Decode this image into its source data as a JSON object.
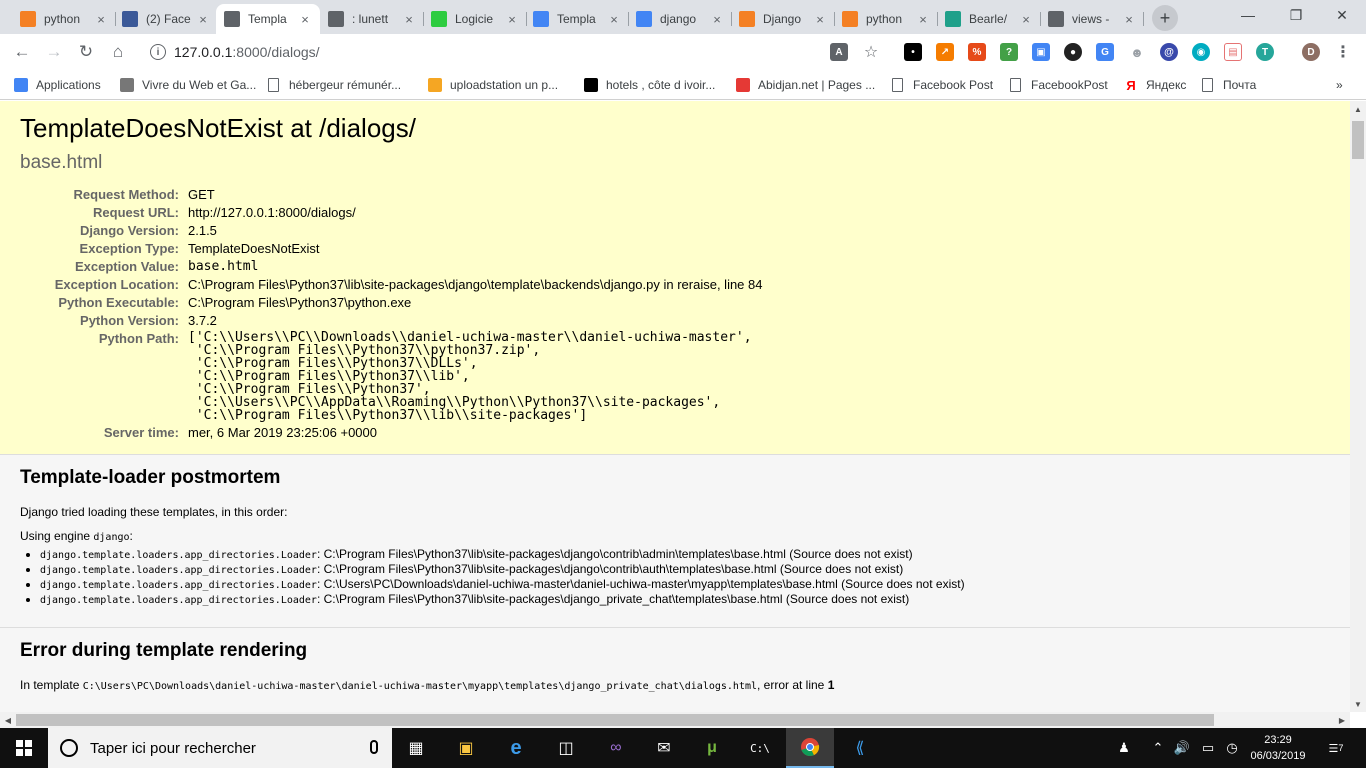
{
  "browser": {
    "tabs": [
      {
        "label": "python",
        "icon": "stackoverflow-icon",
        "color": "#f48024"
      },
      {
        "label": "(2) Face",
        "icon": "facebook-icon",
        "color": "#3b5998"
      },
      {
        "label": "Templa",
        "icon": "document-icon",
        "color": "#5f6368",
        "active": true
      },
      {
        "label": ": lunett",
        "icon": "page-icon",
        "color": "#5f6368"
      },
      {
        "label": "Logicie",
        "icon": "s-icon",
        "color": "#2ecc40"
      },
      {
        "label": "Templa",
        "icon": "google-icon",
        "color": "#4285f4"
      },
      {
        "label": "django",
        "icon": "google-icon",
        "color": "#4285f4"
      },
      {
        "label": "Django",
        "icon": "stackoverflow-icon",
        "color": "#f48024"
      },
      {
        "label": "python",
        "icon": "stackoverflow-icon",
        "color": "#f48024"
      },
      {
        "label": "Bearle/",
        "icon": "dh-icon",
        "color": "#1fa08a"
      },
      {
        "label": "views -",
        "icon": "document-icon",
        "color": "#5f6368"
      }
    ],
    "url_host": "127.0.0.1",
    "url_path": ":8000/dialogs/",
    "profile_initial": "D",
    "bookmarks": [
      {
        "label": "Applications",
        "icon": "apps-grid-icon"
      },
      {
        "label": "Vivre du Web et Ga...",
        "icon": "globe-icon"
      },
      {
        "label": "hébergeur rémunér...",
        "icon": "document-icon"
      },
      {
        "label": "uploadstation un p...",
        "icon": "b-icon"
      },
      {
        "label": "hotels , côte d ivoir...",
        "icon": "pa-icon"
      },
      {
        "label": "Abidjan.net | Pages ...",
        "icon": "at-icon"
      },
      {
        "label": "Facebook Post",
        "icon": "document-icon"
      },
      {
        "label": "FacebookPost",
        "icon": "document-icon"
      },
      {
        "label": "Яндекс",
        "icon": "yandex-icon"
      },
      {
        "label": "Почта",
        "icon": "document-icon"
      }
    ],
    "more_bookmarks": "»"
  },
  "page": {
    "title": "TemplateDoesNotExist at /dialogs/",
    "subtitle": "base.html",
    "meta": [
      {
        "key": "Request Method:",
        "value": "GET"
      },
      {
        "key": "Request URL:",
        "value": "http://127.0.0.1:8000/dialogs/"
      },
      {
        "key": "Django Version:",
        "value": "2.1.5"
      },
      {
        "key": "Exception Type:",
        "value": "TemplateDoesNotExist"
      },
      {
        "key": "Exception Value:",
        "value": "base.html",
        "mono": true
      },
      {
        "key": "Exception Location:",
        "value": "C:\\Program Files\\Python37\\lib\\site-packages\\django\\template\\backends\\django.py in reraise, line 84"
      },
      {
        "key": "Python Executable:",
        "value": "C:\\Program Files\\Python37\\python.exe"
      },
      {
        "key": "Python Version:",
        "value": "3.7.2"
      },
      {
        "key": "Python Path:",
        "value": "['C:\\\\Users\\\\PC\\\\Downloads\\\\daniel-uchiwa-master\\\\daniel-uchiwa-master',\n 'C:\\\\Program Files\\\\Python37\\\\python37.zip',\n 'C:\\\\Program Files\\\\Python37\\\\DLLs',\n 'C:\\\\Program Files\\\\Python37\\\\lib',\n 'C:\\\\Program Files\\\\Python37',\n 'C:\\\\Users\\\\PC\\\\AppData\\\\Roaming\\\\Python\\\\Python37\\\\site-packages',\n 'C:\\\\Program Files\\\\Python37\\\\lib\\\\site-packages']",
        "pre": true
      },
      {
        "key": "Server time:",
        "value": "mer, 6 Mar 2019 23:25:06 +0000"
      }
    ],
    "postmortem": {
      "heading": "Template-loader postmortem",
      "intro": "Django tried loading these templates, in this order:",
      "engine_prefix": "Using engine ",
      "engine_name": "django",
      "engine_suffix": ":",
      "items": [
        {
          "loader": "django.template.loaders.app_directories.Loader",
          "text": "C:\\Program Files\\Python37\\lib\\site-packages\\django\\contrib\\admin\\templates\\base.html (Source does not exist)"
        },
        {
          "loader": "django.template.loaders.app_directories.Loader",
          "text": "C:\\Program Files\\Python37\\lib\\site-packages\\django\\contrib\\auth\\templates\\base.html (Source does not exist)"
        },
        {
          "loader": "django.template.loaders.app_directories.Loader",
          "text": "C:\\Users\\PC\\Downloads\\daniel-uchiwa-master\\daniel-uchiwa-master\\myapp\\templates\\base.html (Source does not exist)"
        },
        {
          "loader": "django.template.loaders.app_directories.Loader",
          "text": "C:\\Program Files\\Python37\\lib\\site-packages\\django_private_chat\\templates\\base.html (Source does not exist)"
        }
      ]
    },
    "rendering": {
      "heading": "Error during template rendering",
      "prefix": "In template ",
      "path": "C:\\Users\\PC\\Downloads\\daniel-uchiwa-master\\daniel-uchiwa-master\\myapp\\templates\\django_private_chat\\dialogs.html",
      "mid": ", error at line ",
      "line": "1"
    }
  },
  "taskbar": {
    "search_placeholder": "Taper ici pour rechercher",
    "time": "23:29",
    "date": "06/03/2019",
    "notifications": "7"
  }
}
